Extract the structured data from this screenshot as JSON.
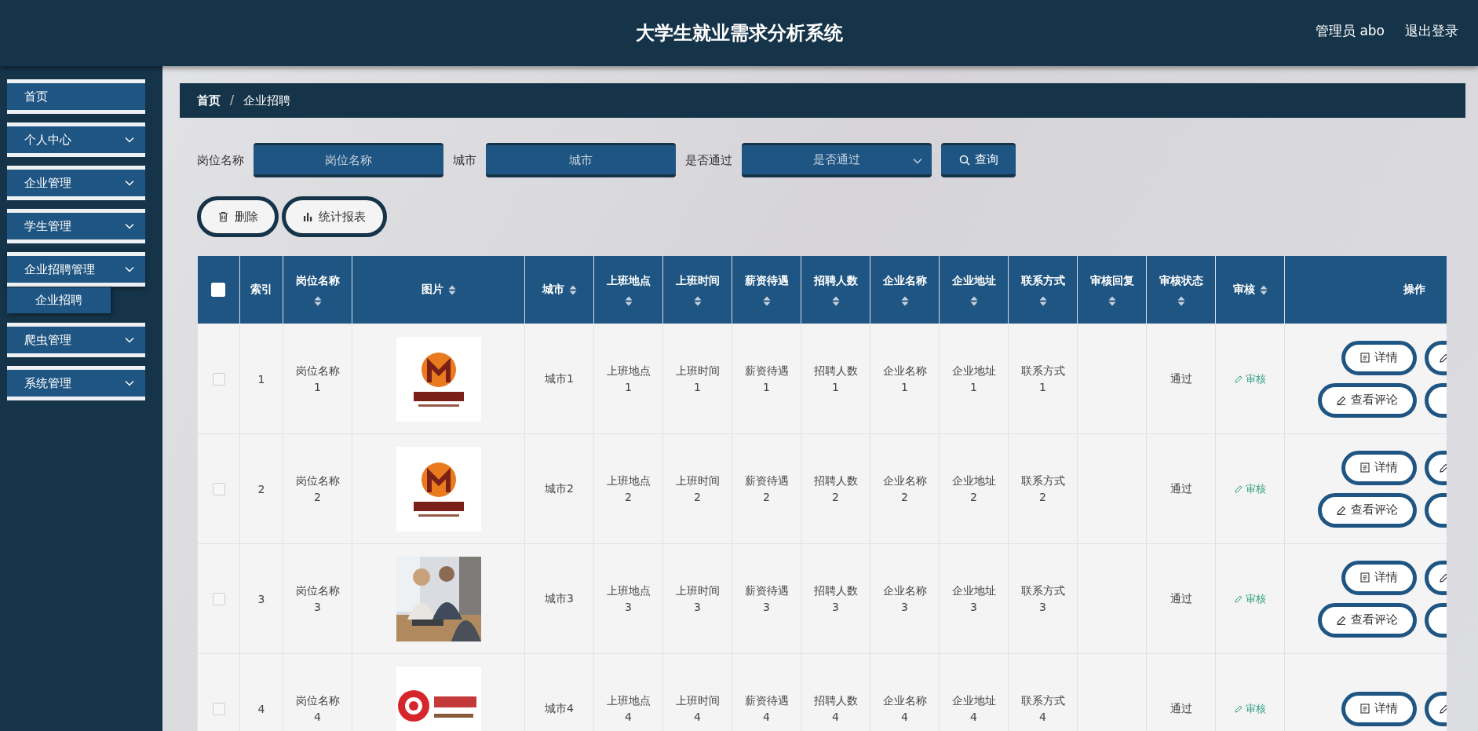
{
  "header": {
    "title": "大学生就业需求分析系统",
    "user": "管理员 abo",
    "logout": "退出登录"
  },
  "sidebar": {
    "items": [
      {
        "label": "首页",
        "kind": "link"
      },
      {
        "label": "个人中心",
        "kind": "menu"
      },
      {
        "label": "企业管理",
        "kind": "menu"
      },
      {
        "label": "学生管理",
        "kind": "menu"
      },
      {
        "label": "企业招聘管理",
        "kind": "menu",
        "expanded": true,
        "children": [
          {
            "label": "企业招聘",
            "selected": true
          }
        ]
      },
      {
        "label": "爬虫管理",
        "kind": "menu"
      },
      {
        "label": "系统管理",
        "kind": "menu"
      }
    ]
  },
  "breadcrumb": {
    "items": [
      "首页",
      "企业招聘"
    ],
    "separator": "/"
  },
  "search": {
    "fields": [
      {
        "label": "岗位名称",
        "placeholder": "岗位名称",
        "kind": "input"
      },
      {
        "label": "城市",
        "placeholder": "城市",
        "kind": "input"
      },
      {
        "label": "是否通过",
        "placeholder": "是否通过",
        "kind": "select"
      }
    ],
    "button": "查询"
  },
  "actions": [
    {
      "label": "删除",
      "kind": "delete"
    },
    {
      "label": "统计报表",
      "kind": "chart"
    }
  ],
  "table": {
    "select_all": {
      "checked": false
    },
    "columns": [
      {
        "label": "索引",
        "sortable": false
      },
      {
        "label": "岗位名称",
        "sortable": true
      },
      {
        "label": "图片",
        "sortable": true
      },
      {
        "label": "城市",
        "sortable": true
      },
      {
        "label": "上班地点",
        "sortable": true
      },
      {
        "label": "上班时间",
        "sortable": true
      },
      {
        "label": "薪资待遇",
        "sortable": true
      },
      {
        "label": "招聘人数",
        "sortable": true
      },
      {
        "label": "企业名称",
        "sortable": true
      },
      {
        "label": "企业地址",
        "sortable": true
      },
      {
        "label": "联系方式",
        "sortable": true
      },
      {
        "label": "审核回复",
        "sortable": true
      },
      {
        "label": "审核状态",
        "sortable": true
      },
      {
        "label": "审核",
        "sortable": true
      },
      {
        "label": "操作",
        "sortable": false
      }
    ],
    "rows": [
      {
        "checked": false,
        "index": "1",
        "name": "岗位名称1",
        "image": {
          "kind": "picture"
        },
        "city": "城市1",
        "place": "上班地点1",
        "time": "上班时间1",
        "salary": "薪资待遇1",
        "count": "招聘人数1",
        "company": "企业名称1",
        "address": "企业地址1",
        "contact": "联系方式1",
        "status": "通过",
        "review": "审核",
        "buttons": [
          "详情",
          "查看评论"
        ]
      },
      {
        "checked": false,
        "index": "2",
        "name": "岗位名称2",
        "image": {
          "kind": "picture"
        },
        "city": "城市2",
        "place": "上班地点2",
        "time": "上班时间2",
        "salary": "薪资待遇2",
        "count": "招聘人数2",
        "company": "企业名称2",
        "address": "企业地址2",
        "contact": "联系方式2",
        "status": "通过",
        "review": "审核",
        "buttons": [
          "详情",
          "查看评论"
        ]
      },
      {
        "checked": false,
        "index": "3",
        "name": "岗位名称3",
        "image": {
          "kind": "picture"
        },
        "city": "城市3",
        "place": "上班地点3",
        "time": "上班时间3",
        "salary": "薪资待遇3",
        "count": "招聘人数3",
        "company": "企业名称3",
        "address": "企业地址3",
        "contact": "联系方式3",
        "status": "通过",
        "review": "审核",
        "buttons": [
          "详情",
          "查看评论"
        ]
      },
      {
        "checked": false,
        "index": "4",
        "name": "岗位名称4",
        "image": {
          "kind": "picture"
        },
        "city": "城市4",
        "place": "上班地点4",
        "time": "上班时间4",
        "salary": "薪资待遇4",
        "count": "招聘人数4",
        "company": "企业名称4",
        "address": "企业地址4",
        "contact": "联系方式4",
        "status": "通过",
        "review": "审核",
        "buttons": [
          "详情"
        ]
      }
    ]
  }
}
